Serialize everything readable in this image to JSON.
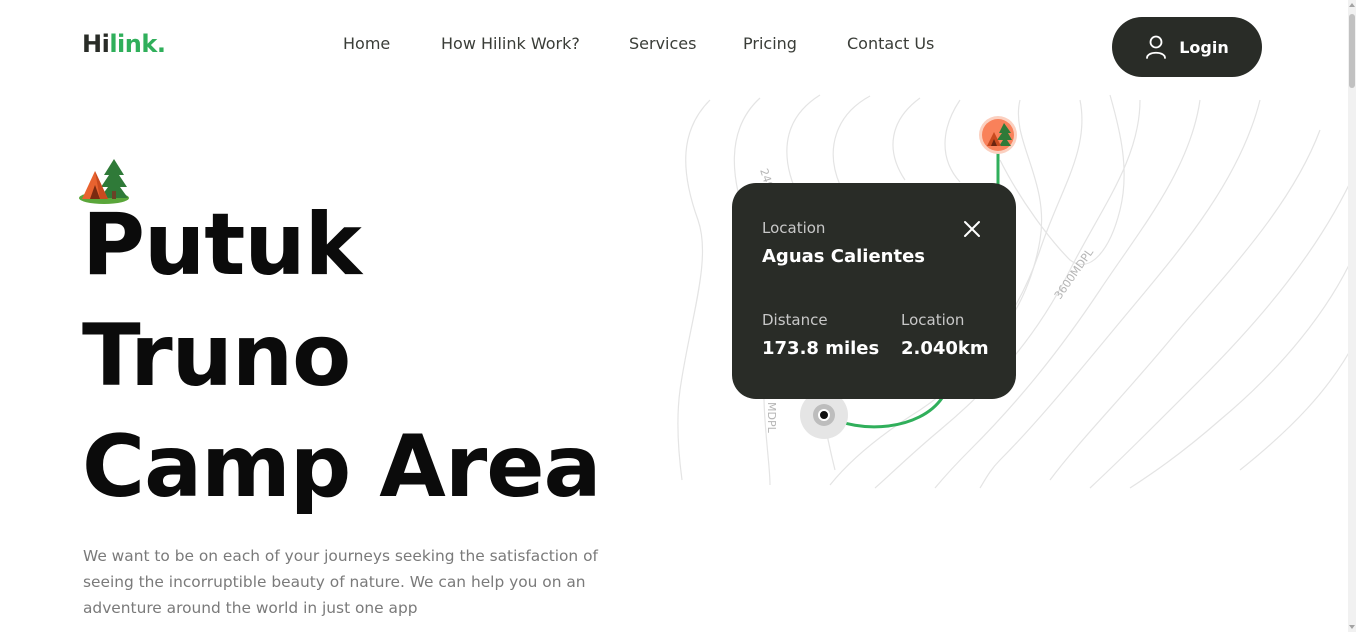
{
  "brand": {
    "logo_main": "Hi",
    "logo_accent": "link.",
    "accent_color": "#30af5b",
    "dark_color": "#292c27"
  },
  "nav": {
    "items": [
      {
        "label": "Home"
      },
      {
        "label": "How Hilink Work?"
      },
      {
        "label": "Services"
      },
      {
        "label": "Pricing"
      },
      {
        "label": "Contact Us"
      }
    ]
  },
  "header": {
    "login_label": "Login",
    "login_icon": "user-icon"
  },
  "hero": {
    "icon": "camp-tent-icon",
    "title_lines": [
      "Putuk",
      "Truno",
      "Camp Area"
    ],
    "description": "We want to be on each of your journeys seeking the satisfaction of seeing the incorruptible beauty of nature. We can help you on an adventure around the world in just one app"
  },
  "map": {
    "contour_labels": [
      "2400MDPL",
      "3600MDPL",
      "MDPL"
    ],
    "pin_icon": "camp-tent-icon",
    "pin_color": "#f9815a"
  },
  "location_card": {
    "location_label": "Location",
    "location_name": "Aguas Calientes",
    "distance_label": "Distance",
    "distance_value": "173.8 miles",
    "elevation_label": "Location",
    "elevation_value": "2.040km",
    "close_icon": "close-icon"
  }
}
